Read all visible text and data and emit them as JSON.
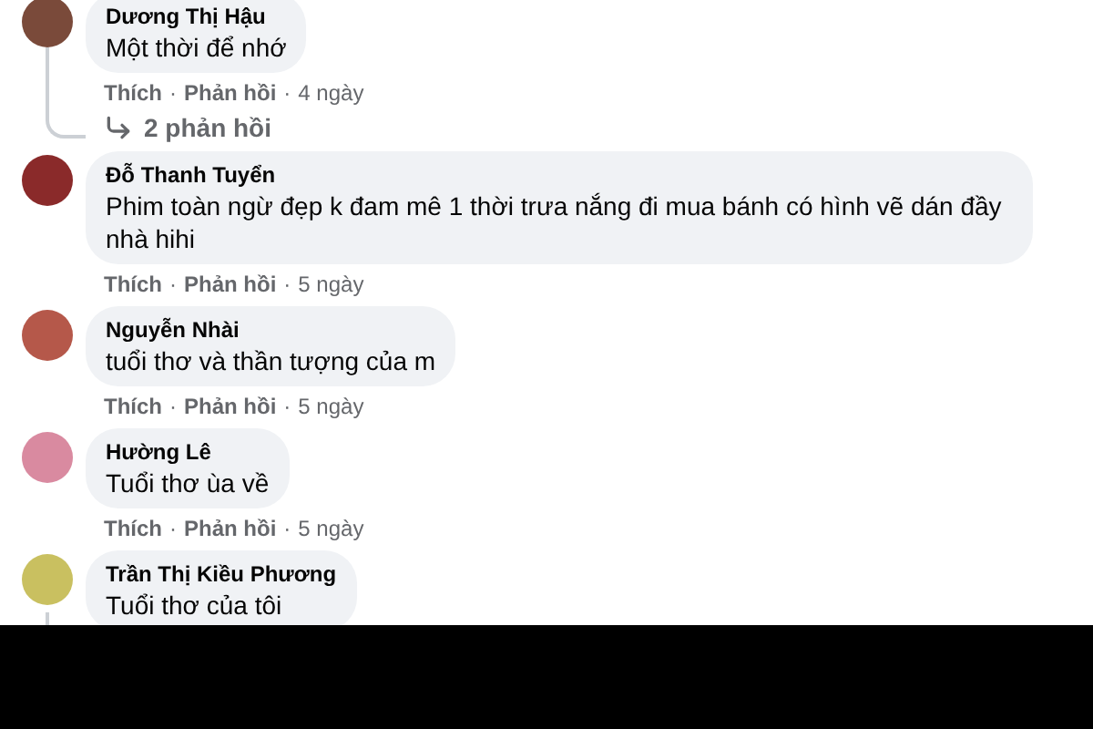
{
  "comments": [
    {
      "name": "Dương Thị Hậu",
      "text": "Một thời để nhớ",
      "like": "Thích",
      "separators": [
        "·",
        "·"
      ],
      "reply": "Phản hồi",
      "time": "4 ngày",
      "replies": "2 phản hồi"
    },
    {
      "name": "Đỗ Thanh Tuyển",
      "text": "Phim toàn ngừ đẹp k đam mê 1 thời trưa nắng đi mua bánh có hình vẽ dán đầy nhà hihi",
      "like": "Thích",
      "separators": [
        "·",
        "·"
      ],
      "reply": "Phản hồi",
      "time": "5 ngày"
    },
    {
      "name": "Nguyễn Nhài",
      "text": "tuổi thơ và thần tượng của m",
      "like": "Thích",
      "separators": [
        "·",
        "·"
      ],
      "reply": "Phản hồi",
      "time": "5 ngày"
    },
    {
      "name": "Hường Lê",
      "text": "Tuổi thơ ùa về",
      "like": "Thích",
      "separators": [
        "·",
        "·"
      ],
      "reply": "Phản hồi",
      "time": "5 ngày"
    },
    {
      "name": "Trần Thị Kiều Phương",
      "text": "Tuổi thơ của tôi"
    }
  ]
}
